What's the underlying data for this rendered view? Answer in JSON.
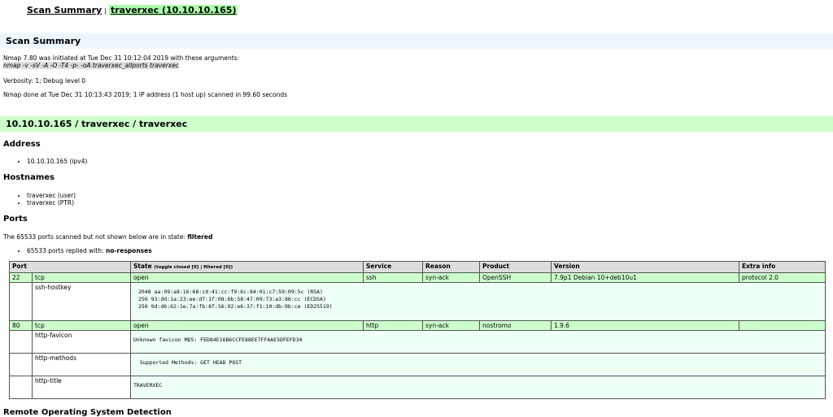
{
  "nav": {
    "summary_link": "Scan Summary",
    "separator": "|",
    "host_link": "traverxec (10.10.10.165)"
  },
  "scan_summary": {
    "heading": "Scan Summary",
    "initiated": "Nmap 7.80 was initiated at Tue Dec 31 10:12:04 2019 with these arguments:",
    "command": "nmap -v -sV -A -O -T4 -p- -oA traverxec_allports traverxec",
    "verbosity": "Verbosity: 1; Debug level 0",
    "done": "Nmap done at Tue Dec 31 10:13:43 2019; 1 IP address (1 host up) scanned in 99.60 seconds"
  },
  "host": {
    "heading": "10.10.10.165 / traverxec / traverxec",
    "address_heading": "Address",
    "addresses": [
      "10.10.10.165 (ipv4)"
    ],
    "hostnames_heading": "Hostnames",
    "hostnames": [
      "traverxec (user)",
      "traverxec (PTR)"
    ],
    "ports_heading": "Ports",
    "filtered_prefix": "The 65533 ports scanned but not shown below are in state: ",
    "filtered_state": "filtered",
    "replied_prefix": "65533 ports replied with: ",
    "replied_value": "no-responses"
  },
  "table": {
    "headers": {
      "port": "Port",
      "state": "State",
      "toggle_closed": "(toggle closed [0]",
      "toggle_sep": " | ",
      "toggle_filtered": "filtered [0])",
      "service": "Service",
      "reason": "Reason",
      "product": "Product",
      "version": "Version",
      "extra": "Extra info"
    },
    "rows": [
      {
        "port": "22",
        "proto": "tcp",
        "state": "open",
        "service": "ssh",
        "reason": "syn-ack",
        "product": "OpenSSH",
        "version": "7.9p1 Debian 10+deb10u1",
        "extra": "protocol 2.0"
      },
      {
        "port": "80",
        "proto": "tcp",
        "state": "open",
        "service": "http",
        "reason": "syn-ack",
        "product": "nostromo",
        "version": "1.9.6",
        "extra": ""
      }
    ],
    "scripts": {
      "ssh_hostkey": {
        "name": "ssh-hostkey",
        "output": "2048 aa:99:a8:16:68:cd:41:cc:f9:6c:84:01:c7:59:09:5c (RSA)\n256 93:dd:1a:23:ee:d7:1f:08:6b:58:47:09:73:a3:88:cc (ECDSA)\n256 9d:d6:62:1e:7a:fb:8f:56:92:e6:37:f1:10:db:9b:ce (ED25519)"
      },
      "http_favicon": {
        "name": "http-favicon",
        "output": "Unknown favicon MD5: FED84E16B6CCFE88EE7FFAAE5DFEFD34"
      },
      "http_methods": {
        "name": "http-methods",
        "output": "  Supported Methods: GET HEAD POST"
      },
      "http_title": {
        "name": "http-title",
        "output": "TRAVERXEC"
      }
    }
  },
  "next_section": "Remote Operating System Detection"
}
